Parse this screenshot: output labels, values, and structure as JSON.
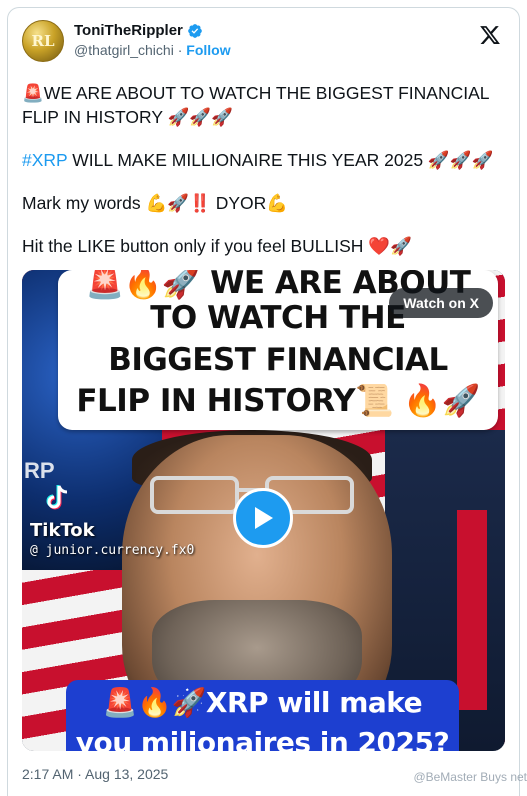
{
  "tweet": {
    "avatar_text": "RL",
    "display_name": "ToniTheRippler",
    "handle": "@thatgirl_chichi",
    "separator": "·",
    "follow_label": "Follow",
    "paragraphs": {
      "p1": {
        "emoji": "🚨",
        "text": "WE ARE ABOUT TO WATCH THE BIGGEST FINANCIAL FLIP IN HISTORY ",
        "emoji_end": "🚀🚀🚀"
      },
      "p2": {
        "hashtag": "#XRP",
        "text": " WILL MAKE MILLIONAIRE THIS YEAR 2025 ",
        "emoji_end": "🚀🚀🚀"
      },
      "p3": {
        "text": "Mark my words ",
        "emoji_mid": "💪🚀‼️",
        "text2": " DYOR",
        "emoji_end": "💪"
      },
      "p4": {
        "text": "Hit the LIKE button only if you feel BULLISH ",
        "emoji_end": "❤️🚀"
      }
    },
    "timestamp": "2:17 AM · Aug 13, 2025"
  },
  "media": {
    "watch_label": "Watch on X",
    "banner_top_lines": [
      "🚨🔥🚀 WE ARE ABOUT",
      "TO WATCH THE",
      "BIGGEST FINANCIAL",
      "FLIP IN HISTORY📜 🔥🚀"
    ],
    "xrp_partial": "RP",
    "tiktok_brand": "TikTok",
    "tiktok_handle": "@ junior.currency.fx0",
    "banner_bottom_lines": [
      "🚨🔥🚀XRP will make",
      "you milionaires in 2025?"
    ]
  },
  "watermark": "@BeMaster Buys net",
  "colors": {
    "accent": "#1d9bf0",
    "text": "#0f1419",
    "muted": "#536471",
    "border": "#cfd9de"
  }
}
